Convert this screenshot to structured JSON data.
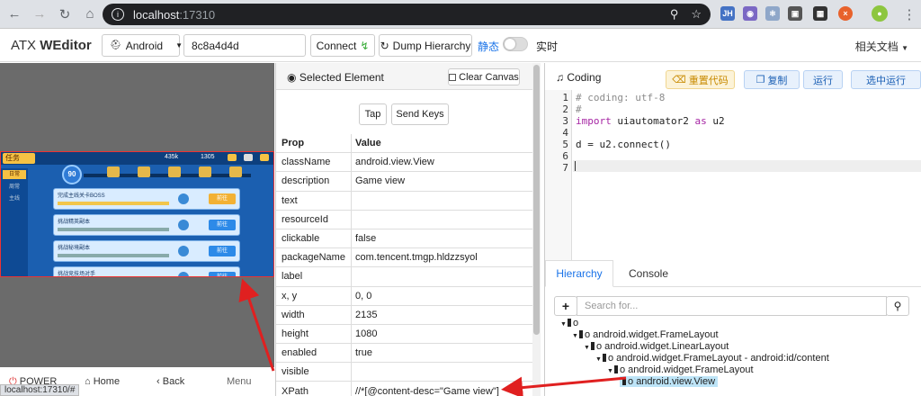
{
  "browser": {
    "url_host": "localhost",
    "url_port": ":17310",
    "ext_jh": "JH",
    "status_url": "localhost:17310/#"
  },
  "header": {
    "logo_atx": "ATX",
    "logo_weditor": "WEditor",
    "platform": "Android",
    "serial": "8c8a4d4d",
    "connect_label": "Connect",
    "dump_label": "Dump Hierarchy",
    "static_label": "静态",
    "realtime_label": "实时",
    "docs_label": "相关文档"
  },
  "device": {
    "softkeys": {
      "power": "POWER",
      "home": "Home",
      "back": "Back",
      "menu": "Menu"
    },
    "game": {
      "task_label": "任务",
      "side_items": [
        "日常",
        "周常",
        "主线"
      ],
      "currency": [
        "435k",
        "1305"
      ],
      "level": "90",
      "tasks": [
        "完成主线关卡BOSS",
        "挑战精英副本",
        "挑战秘境副本",
        "挑战竞技场对手"
      ],
      "btn_label": "前往"
    }
  },
  "selected": {
    "title": "Selected Element",
    "clear_canvas": "Clear Canvas",
    "tap": "Tap",
    "send_keys": "Send Keys",
    "col_prop": "Prop",
    "col_value": "Value",
    "rows": [
      {
        "prop": "className",
        "value": "android.view.View"
      },
      {
        "prop": "description",
        "value": "Game view"
      },
      {
        "prop": "text",
        "value": ""
      },
      {
        "prop": "resourceId",
        "value": ""
      },
      {
        "prop": "clickable",
        "value": "false"
      },
      {
        "prop": "packageName",
        "value": "com.tencent.tmgp.hldzzsyol"
      },
      {
        "prop": "label",
        "value": ""
      },
      {
        "prop": "x, y",
        "value": "0, 0"
      },
      {
        "prop": "width",
        "value": "2135"
      },
      {
        "prop": "height",
        "value": "1080"
      },
      {
        "prop": "enabled",
        "value": "true"
      },
      {
        "prop": "visible",
        "value": ""
      },
      {
        "prop": "XPath",
        "value": "//*[@content-desc=\"Game view\"]"
      }
    ]
  },
  "coding": {
    "title": "Coding",
    "reset_label": "重置代码",
    "copy_label": "复制",
    "run_label": "运行",
    "run_selected_label": "选中运行",
    "lines": [
      {
        "n": "1",
        "text": "# coding: utf-8"
      },
      {
        "n": "2",
        "text": "#"
      },
      {
        "n": "3",
        "text": "import uiautomator2 as u2"
      },
      {
        "n": "4",
        "text": ""
      },
      {
        "n": "5",
        "text": "d = u2.connect()"
      },
      {
        "n": "6",
        "text": ""
      },
      {
        "n": "7",
        "text": ""
      }
    ]
  },
  "bottom": {
    "tab_hierarchy": "Hierarchy",
    "tab_console": "Console",
    "search_placeholder": "Search for...",
    "tree": [
      {
        "label": "",
        "indent": 0
      },
      {
        "label": "android.widget.FrameLayout",
        "indent": 1
      },
      {
        "label": "android.widget.LinearLayout",
        "indent": 2
      },
      {
        "label": "android.widget.FrameLayout - android:id/content",
        "indent": 3
      },
      {
        "label": "android.widget.FrameLayout",
        "indent": 4
      },
      {
        "label": "android.view.View",
        "indent": 5,
        "selected": true
      }
    ]
  },
  "colors": {
    "accent": "#1a73e8",
    "selected_bg": "#bde4f7",
    "arrow": "#e02020"
  }
}
